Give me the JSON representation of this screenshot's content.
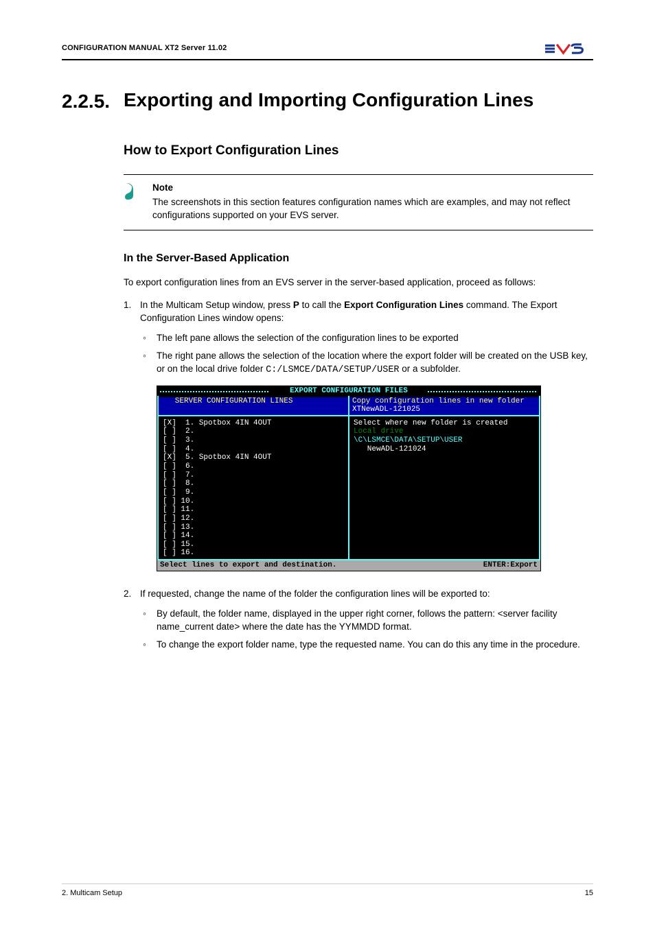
{
  "header": {
    "doc_title": "CONFIGURATION MANUAL  XT2 Server 11.02",
    "logo_alt": "EVS"
  },
  "section": {
    "number": "2.2.5.",
    "title": "Exporting and Importing Configuration Lines"
  },
  "h3": "How to Export Configuration Lines",
  "note": {
    "label": "Note",
    "text": "The screenshots in this section features configuration names which are examples, and may not reflect configurations supported on your EVS server."
  },
  "h4": "In the Server-Based Application",
  "intro": "To export configuration lines from an EVS server in the server-based application, proceed as follows:",
  "step1": {
    "num": "1.",
    "text_a": "In the Multicam Setup window, press ",
    "key": "P",
    "text_b": " to call the ",
    "bold_cmd": "Export Configuration Lines",
    "text_c": " command. The Export Configuration Lines window opens:",
    "bullet1": "The left pane allows the selection of the configuration lines to be exported",
    "bullet2_a": "The right pane allows the selection of the location where the export folder will be created on the USB key, or on the local drive folder ",
    "bullet2_path": "C:/LSMCE/DATA/SETUP/USER",
    "bullet2_b": " or a subfolder."
  },
  "terminal": {
    "title": "EXPORT CONFIGURATION FILES",
    "left_header": "   SERVER CONFIGURATION LINES",
    "right_header_l1": "Copy configuration lines in new folder",
    "right_header_l2": "XTNewADL-121025",
    "left_lines": [
      "[X]  1. Spotbox 4IN 4OUT",
      "[ ]  2.",
      "[ ]  3.",
      "[ ]  4.",
      "[X]  5. Spotbox 4IN 4OUT",
      "[ ]  6.",
      "[ ]  7.",
      "[ ]  8.",
      "[ ]  9.",
      "[ ] 10.",
      "[ ] 11.",
      "[ ] 12.",
      "[ ] 13.",
      "[ ] 14.",
      "[ ] 15.",
      "[ ] 16."
    ],
    "right_lines": [
      {
        "text": "Select where new folder is created",
        "cls": ""
      },
      {
        "text": "Local drive",
        "cls": "localdrive"
      },
      {
        "text": "\\C\\LSMCE\\DATA\\SETUP\\USER",
        "cls": "cyan"
      },
      {
        "text": "   NewADL-121024",
        "cls": ""
      }
    ],
    "footer_left": "Select lines to export and destination.",
    "footer_right": "ENTER:Export"
  },
  "step2": {
    "num": "2.",
    "text": "If requested, change the name of the folder the configuration lines will be exported to:",
    "bullet1": "By default, the folder name, displayed in the upper right corner, follows the pattern: <server facility name_current date> where the date has the YYMMDD format.",
    "bullet2": "To change the export folder name, type the requested name. You can do this any time in the procedure."
  },
  "footer": {
    "left": "2. Multicam Setup",
    "right": "15"
  }
}
